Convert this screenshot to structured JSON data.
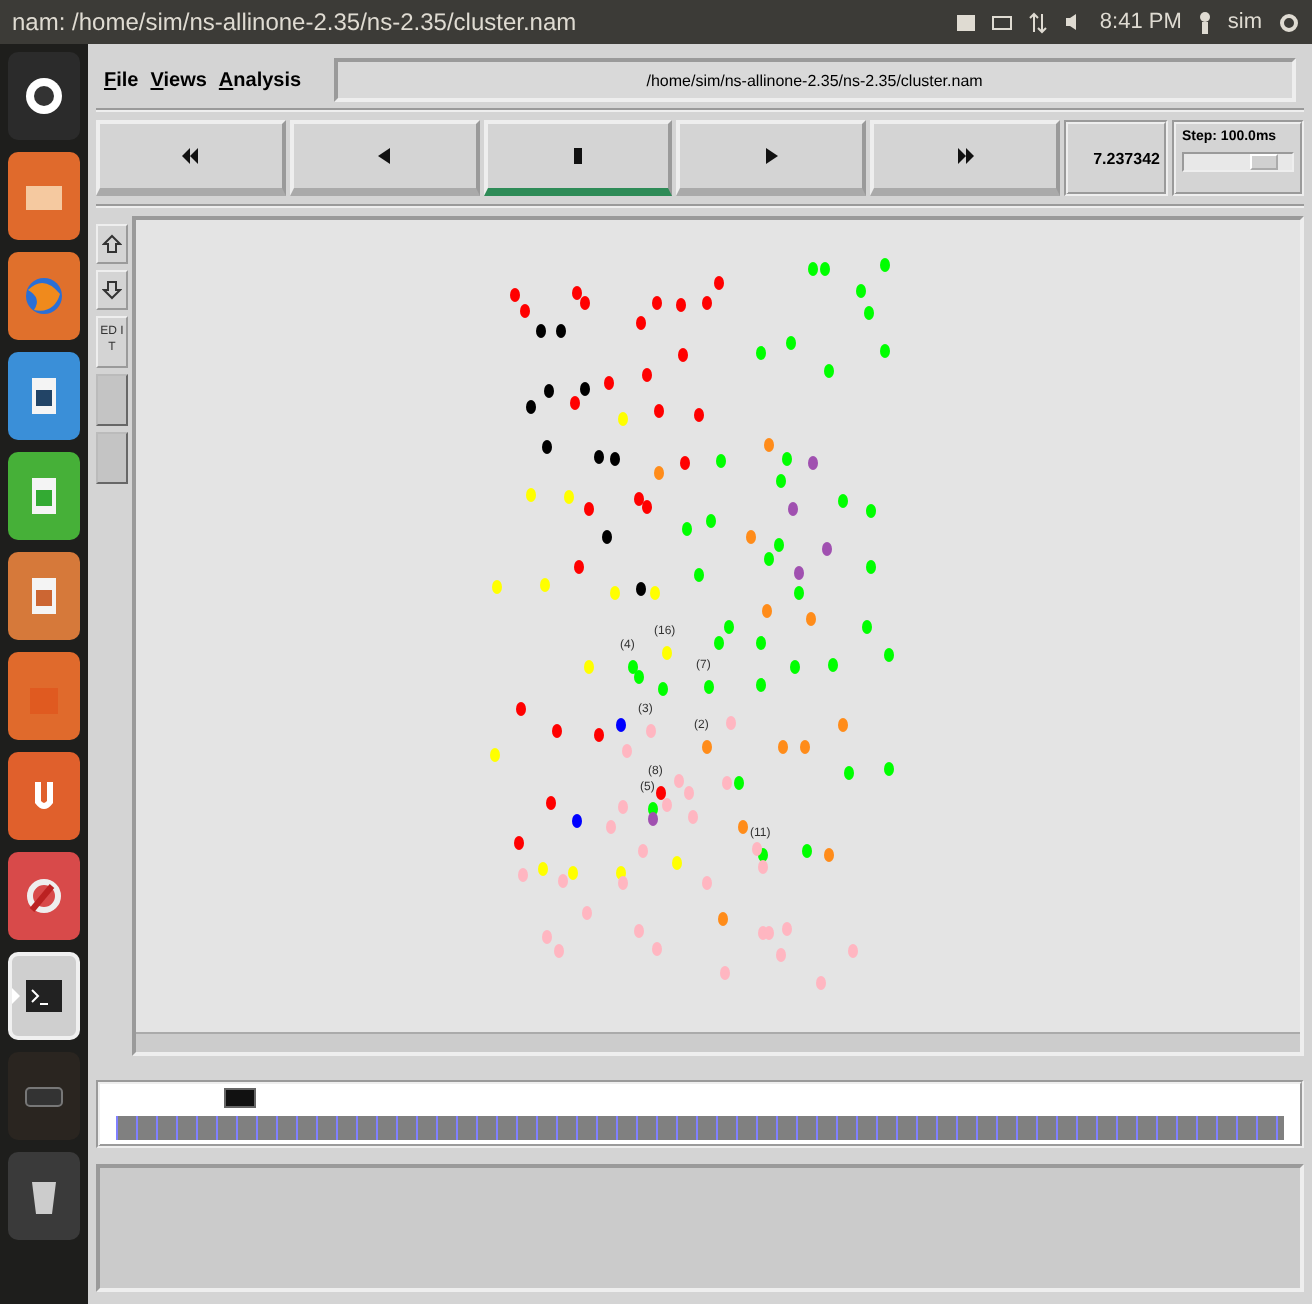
{
  "top_panel": {
    "title": "nam: /home/sim/ns-allinone-2.35/ns-2.35/cluster.nam",
    "clock": "8:41 PM",
    "user": "sim"
  },
  "launcher": [
    {
      "kind": "dash",
      "active": false
    },
    {
      "kind": "files",
      "active": false
    },
    {
      "kind": "browser",
      "active": false
    },
    {
      "kind": "writer",
      "active": false
    },
    {
      "kind": "calc",
      "active": false
    },
    {
      "kind": "impress",
      "active": false
    },
    {
      "kind": "store",
      "active": false
    },
    {
      "kind": "cloud",
      "active": false
    },
    {
      "kind": "settings",
      "active": false
    },
    {
      "kind": "terminal",
      "active": true
    },
    {
      "kind": "workspaces",
      "active": false
    },
    {
      "kind": "trash",
      "active": false
    }
  ],
  "menu": [
    "File",
    "Views",
    "Analysis"
  ],
  "path_field": "/home/sim/ns-allinone-2.35/ns-2.35/cluster.nam",
  "playback": [
    {
      "kind": "rewind",
      "selected": false
    },
    {
      "kind": "back",
      "selected": false
    },
    {
      "kind": "stop",
      "selected": true
    },
    {
      "kind": "play",
      "selected": false
    },
    {
      "kind": "forward",
      "selected": false
    }
  ],
  "time": "7.237342",
  "step": {
    "label": "Step: 100.0ms",
    "level": 0.82
  },
  "tools": [
    {
      "kind": "zoom-in",
      "disabled": false
    },
    {
      "kind": "zoom-out",
      "disabled": false
    },
    {
      "kind": "text",
      "label": "ED IT",
      "disabled": false
    },
    {
      "kind": "blank",
      "disabled": true
    },
    {
      "kind": "blank",
      "disabled": true
    }
  ],
  "nodes": [
    {
      "color": "#ff0000"
    },
    {
      "color": "#ff0000"
    },
    {
      "color": "#ff0000"
    },
    {
      "color": "#ff0000"
    },
    {
      "color": "#ff0000"
    },
    {
      "color": "#ff0000"
    },
    {
      "color": "#ff0000"
    },
    {
      "color": "#ff0000"
    },
    {
      "color": "#ff0000"
    },
    {
      "color": "#ff0000"
    },
    {
      "color": "#ff0000"
    },
    {
      "color": "#ff0000"
    },
    {
      "color": "#ff0000"
    },
    {
      "color": "#ff0000"
    },
    {
      "color": "#ff0000"
    },
    {
      "color": "#ff0000"
    },
    {
      "color": "#ff0000"
    },
    {
      "color": "#ff0000"
    },
    {
      "color": "#ff0000"
    },
    {
      "color": "#ff0000"
    },
    {
      "color": "#000000"
    },
    {
      "color": "#000000"
    },
    {
      "color": "#000000"
    },
    {
      "color": "#000000"
    },
    {
      "color": "#000000"
    },
    {
      "color": "#000000"
    },
    {
      "color": "#000000"
    },
    {
      "color": "#000000"
    },
    {
      "color": "#000000"
    },
    {
      "color": "#000000"
    },
    {
      "color": "#ffff00"
    },
    {
      "color": "#ffff00"
    },
    {
      "color": "#ffff00"
    },
    {
      "color": "#ffff00"
    },
    {
      "color": "#ffff00"
    },
    {
      "color": "#ffff00"
    },
    {
      "color": "#ffff00"
    },
    {
      "color": "#00ff00"
    },
    {
      "color": "#00ff00"
    },
    {
      "color": "#00ff00"
    },
    {
      "color": "#00ff00"
    },
    {
      "color": "#00ff00"
    },
    {
      "color": "#00ff00"
    },
    {
      "color": "#00ff00"
    },
    {
      "color": "#00ff00"
    },
    {
      "color": "#00ff00"
    },
    {
      "color": "#00ff00"
    },
    {
      "color": "#00ff00"
    },
    {
      "color": "#00ff00"
    },
    {
      "color": "#00ff00"
    },
    {
      "color": "#00ff00"
    },
    {
      "color": "#00ff00"
    },
    {
      "color": "#00ff00"
    },
    {
      "color": "#00ff00"
    },
    {
      "color": "#00ff00"
    },
    {
      "color": "#00ff00"
    },
    {
      "color": "#00ff00"
    },
    {
      "color": "#00ff00"
    },
    {
      "color": "#00ff00"
    },
    {
      "color": "#00ff00"
    },
    {
      "color": "#ff8c1a"
    },
    {
      "color": "#ff8c1a"
    },
    {
      "color": "#ff8c1a"
    },
    {
      "color": "#ff8c1a"
    },
    {
      "color": "#ff8c1a"
    },
    {
      "color": "#a050b0"
    },
    {
      "color": "#a050b0"
    },
    {
      "color": "#a050b0"
    },
    {
      "color": "#a050b0"
    },
    {
      "color": "#ffff00",
      "label": "(16)"
    },
    {
      "color": "#ffff00"
    },
    {
      "color": "#ffff00"
    },
    {
      "color": "#ffff00"
    },
    {
      "color": "#ffff00"
    },
    {
      "color": "#ffff00"
    },
    {
      "color": "#ffff00"
    },
    {
      "color": "#00ff00",
      "label": "(4)"
    },
    {
      "color": "#00ff00",
      "label": "(7)"
    },
    {
      "color": "#00ff00",
      "label": "(11)"
    },
    {
      "color": "#00ff00",
      "label": "(5)"
    },
    {
      "color": "#00ff00"
    },
    {
      "color": "#00ff00"
    },
    {
      "color": "#00ff00"
    },
    {
      "color": "#00ff00"
    },
    {
      "color": "#00ff00"
    },
    {
      "color": "#00ff00"
    },
    {
      "color": "#00ff00"
    },
    {
      "color": "#00ff00"
    },
    {
      "color": "#00ff00"
    },
    {
      "color": "#00ff00"
    },
    {
      "color": "#00ff00"
    },
    {
      "color": "#00ff00"
    },
    {
      "color": "#ff0000",
      "label": "(8)"
    },
    {
      "color": "#ff0000"
    },
    {
      "color": "#ff0000"
    },
    {
      "color": "#ff0000"
    },
    {
      "color": "#ff0000"
    },
    {
      "color": "#ff0000"
    },
    {
      "color": "#0000ff"
    },
    {
      "color": "#0000ff"
    },
    {
      "color": "#ff8c1a",
      "label": "(2)"
    },
    {
      "color": "#ff8c1a"
    },
    {
      "color": "#ff8c1a"
    },
    {
      "color": "#ff8c1a"
    },
    {
      "color": "#ff8c1a"
    },
    {
      "color": "#ff8c1a"
    },
    {
      "color": "#ff8c1a"
    },
    {
      "color": "#a050b0"
    },
    {
      "color": "#ffb6c1",
      "label": "(3)"
    },
    {
      "color": "#ffb6c1"
    },
    {
      "color": "#ffb6c1"
    },
    {
      "color": "#ffb6c1"
    },
    {
      "color": "#ffb6c1"
    },
    {
      "color": "#ffb6c1"
    },
    {
      "color": "#ffb6c1"
    },
    {
      "color": "#ffb6c1"
    },
    {
      "color": "#ffb6c1"
    },
    {
      "color": "#ffb6c1"
    },
    {
      "color": "#ffb6c1"
    },
    {
      "color": "#ffb6c1"
    },
    {
      "color": "#ffb6c1"
    },
    {
      "color": "#ffb6c1"
    },
    {
      "color": "#ffb6c1"
    },
    {
      "color": "#ffb6c1"
    },
    {
      "color": "#ffb6c1"
    },
    {
      "color": "#ffb6c1"
    },
    {
      "color": "#ffb6c1"
    },
    {
      "color": "#ffb6c1"
    },
    {
      "color": "#ffb6c1"
    },
    {
      "color": "#ffb6c1"
    },
    {
      "color": "#ffb6c1"
    },
    {
      "color": "#ffb6c1"
    },
    {
      "color": "#ffb6c1"
    },
    {
      "color": "#ffb6c1"
    },
    {
      "color": "#ffb6c1"
    },
    {
      "color": "#ffb6c1"
    },
    {
      "color": "#ffb6c1"
    }
  ]
}
